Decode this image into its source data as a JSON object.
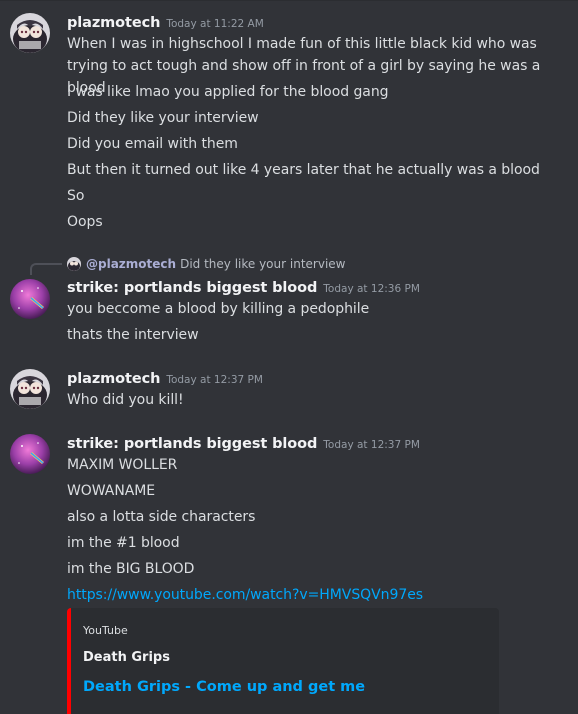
{
  "messages": [
    {
      "username": "plazmotech",
      "timestamp": "Today at 11:22 AM",
      "lines": [
        "When I was in highschool I made fun of this little black kid who was trying to act tough and show off in front of a girl by saying he was a blood",
        "I was like lmao you applied for the blood gang",
        "Did they like your interview",
        "Did you email with them",
        "But then it turned out like 4 years later that he actually was a blood",
        "So",
        "Oops"
      ]
    },
    {
      "reply": {
        "mention": "@plazmotech",
        "text": "Did they like your interview"
      },
      "username": "strike: portlands biggest blood",
      "timestamp": "Today at 12:36 PM",
      "lines": [
        "you beccome a blood by killing a pedophile",
        "thats the interview"
      ]
    },
    {
      "username": "plazmotech",
      "timestamp": "Today at 12:37 PM",
      "lines": [
        "Who did you kill!"
      ]
    },
    {
      "username": "strike: portlands biggest blood",
      "timestamp": "Today at 12:37 PM",
      "lines": [
        "MAXIM WOLLER",
        "WOWANAME",
        "also a lotta side characters",
        "im the #1 blood",
        "im the BIG BLOOD"
      ],
      "link": "https://www.youtube.com/watch?v=HMVSQVn97es",
      "embed": {
        "provider": "YouTube",
        "author": "Death Grips",
        "title": "Death Grips - Come up and get me"
      }
    }
  ],
  "colors": {
    "background": "#313338",
    "embed_accent": "#ff0000",
    "link": "#00a8fc"
  },
  "icons": {
    "plazmotech_avatar": "anime-girls-avatar-icon",
    "strike_avatar": "pink-galaxy-avatar-icon"
  }
}
